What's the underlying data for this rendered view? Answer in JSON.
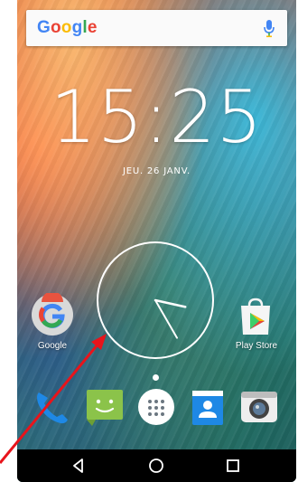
{
  "search": {
    "logo_letters": [
      {
        "ch": "G",
        "color": "#4285F4"
      },
      {
        "ch": "o",
        "color": "#EA4335"
      },
      {
        "ch": "o",
        "color": "#FBBC05"
      },
      {
        "ch": "g",
        "color": "#4285F4"
      },
      {
        "ch": "l",
        "color": "#34A853"
      },
      {
        "ch": "e",
        "color": "#EA4335"
      }
    ],
    "mic_icon": "microphone-icon"
  },
  "clock": {
    "time": "15:25",
    "date": "JEU. 26 JANV."
  },
  "analog_clock": {
    "hour": 15,
    "minute": 25
  },
  "apps": {
    "google": {
      "label": "Google",
      "icon": "google-app-icon"
    },
    "play_store": {
      "label": "Play Store",
      "icon": "play-store-icon"
    }
  },
  "dock": [
    {
      "name": "phone",
      "icon": "phone-icon"
    },
    {
      "name": "messaging",
      "icon": "messaging-icon"
    },
    {
      "name": "app-drawer",
      "icon": "app-drawer-icon"
    },
    {
      "name": "contacts",
      "icon": "contacts-icon"
    },
    {
      "name": "camera",
      "icon": "camera-icon"
    }
  ],
  "navbar": {
    "back": "back-icon",
    "home": "home-icon",
    "recents": "recents-icon"
  },
  "colors": {
    "annotation_arrow": "#e8141b",
    "dock_phone": "#1e88e5",
    "dock_messaging": "#8bc34a",
    "dock_contacts": "#1e88e5"
  }
}
